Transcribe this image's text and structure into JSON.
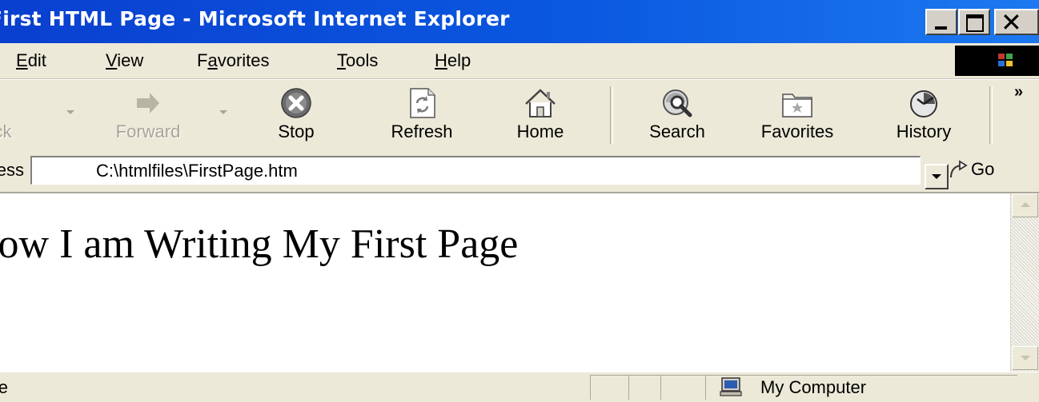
{
  "window": {
    "title": "First HTML Page - Microsoft Internet Explorer",
    "close_glyph": "✕"
  },
  "menu": {
    "items": [
      {
        "label": "Edit",
        "accel": "E"
      },
      {
        "label": "View",
        "accel": "V"
      },
      {
        "label": "Favorites",
        "accel": "a"
      },
      {
        "label": "Tools",
        "accel": "T"
      },
      {
        "label": "Help",
        "accel": "H"
      }
    ]
  },
  "toolbar": {
    "back_label": "Back",
    "forward_label": "Forward",
    "stop_label": "Stop",
    "refresh_label": "Refresh",
    "home_label": "Home",
    "search_label": "Search",
    "favorites_label": "Favorites",
    "history_label": "History",
    "overflow_glyph": "»",
    "icons": [
      "back-arrow-icon",
      "forward-arrow-icon",
      "stop-icon",
      "refresh-icon",
      "home-icon",
      "search-icon",
      "favorites-folder-icon",
      "history-icon"
    ]
  },
  "address": {
    "label": "Address",
    "value": "C:\\htmlfiles\\FirstPage.htm",
    "go_label": "Go"
  },
  "content": {
    "heading": "Now I am Writing My First Page"
  },
  "status": {
    "text": "Done",
    "zone": "My Computer"
  },
  "colors": {
    "title_bar": "#0a58e0",
    "chrome": "#ece9d8",
    "content_bg": "#ffffff"
  }
}
